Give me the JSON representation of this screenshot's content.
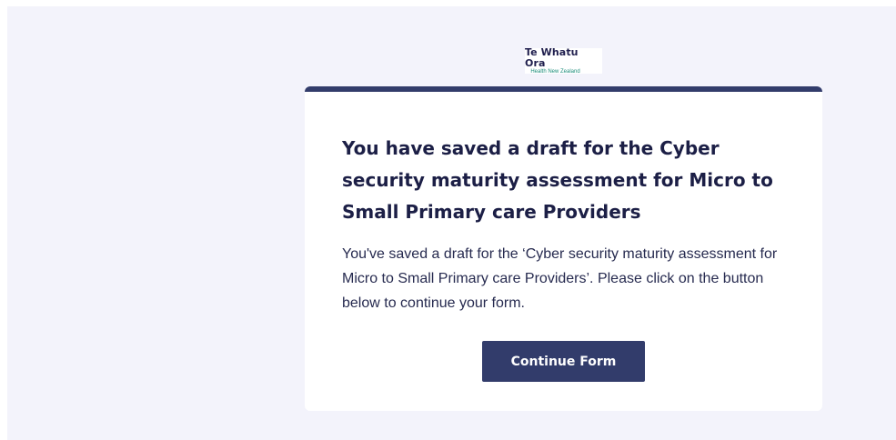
{
  "logo": {
    "title": "Te Whatu Ora",
    "subtitle": "Health New Zealand"
  },
  "card": {
    "title": "You have saved a draft for the Cyber security maturity assessment for Micro to Small Primary care Providers",
    "body": "You've saved a draft for the ‘Cyber security maturity assessment for Micro to Small Primary care Providers’. Please click on the button below to continue your form.",
    "button_label": "Continue Form",
    "accent_color": "#323c6b"
  }
}
